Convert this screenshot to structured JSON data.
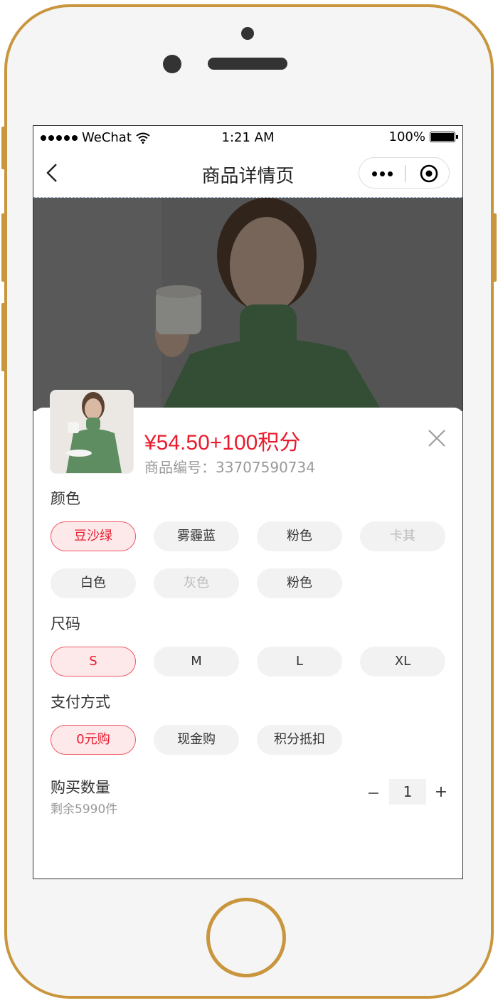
{
  "statusbar": {
    "signal_label": "WeChat",
    "time": "1:21 AM",
    "battery": "100%"
  },
  "navbar": {
    "title": "商品详情页"
  },
  "product": {
    "price": "¥54.50+100积分",
    "sku": "商品编号：33707590734"
  },
  "sections": {
    "color": {
      "label": "颜色",
      "options": [
        "豆沙绿",
        "雾霾蓝",
        "粉色",
        "卡其",
        "白色",
        "灰色",
        "粉色"
      ],
      "selected": "豆沙绿",
      "disabled": [
        "卡其",
        "灰色"
      ]
    },
    "size": {
      "label": "尺码",
      "options": [
        "S",
        "M",
        "L",
        "XL"
      ],
      "selected": "S"
    },
    "payment": {
      "label": "支付方式",
      "options": [
        "0元购",
        "现金购",
        "积分抵扣"
      ],
      "selected": "0元购"
    }
  },
  "quantity": {
    "label": "购买数量",
    "remaining": "剩余5990件",
    "value": "1",
    "minus": "−",
    "plus": "+"
  },
  "colors": {
    "frame": "#c9963e",
    "accent": "#e81c2e",
    "chip_bg": "#f2f2f2",
    "chip_active_bg": "#fde8ea"
  }
}
